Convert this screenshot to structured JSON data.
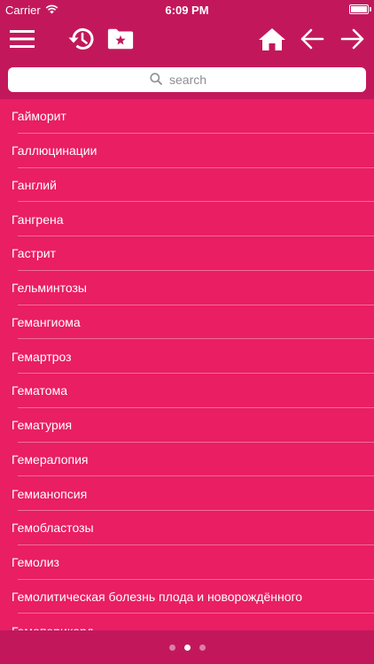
{
  "status_bar": {
    "carrier": "Carrier",
    "time": "6:09 PM"
  },
  "toolbar": {
    "icons": [
      "menu-icon",
      "history-icon",
      "favorites-folder-icon",
      "home-icon",
      "arrow-left-icon",
      "arrow-right-icon"
    ]
  },
  "search": {
    "placeholder": "search"
  },
  "list": {
    "items": [
      "Гайморит",
      "Галлюцинации",
      "Ганглий",
      "Гангрена",
      "Гастрит",
      "Гельминтозы",
      "Гемангиома",
      "Гемартроз",
      "Гематома",
      "Гематурия",
      "Гемералопия",
      "Гемианопсия",
      "Гемобластозы",
      "Гемолиз",
      "Гемолитическая болезнь плода и новорождённого",
      "Гемоперикард"
    ]
  },
  "pager": {
    "count": 3,
    "active_index": 1
  },
  "colors": {
    "primary": "#E91E63",
    "primary_dark": "#C2185B"
  }
}
